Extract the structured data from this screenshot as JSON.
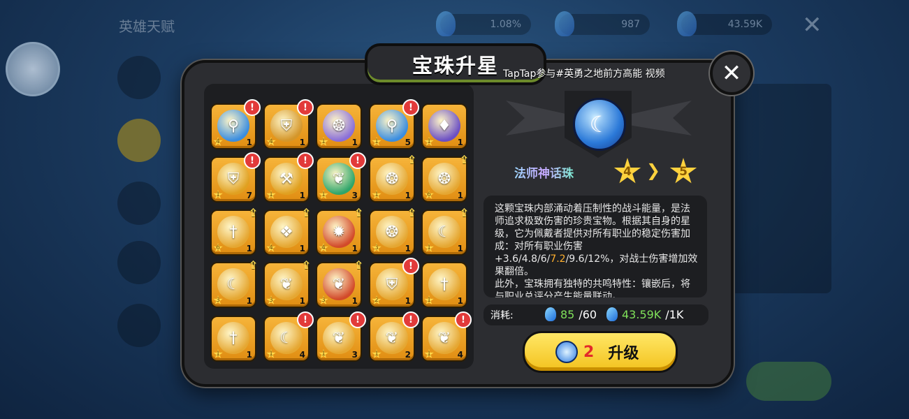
{
  "background": {
    "hud_title": "英雄天赋",
    "resources": [
      "1.08%",
      "987",
      "43.59K"
    ],
    "colors": {
      "bg_dark": "#0f2440",
      "bg_light": "#2d5a86"
    }
  },
  "modal": {
    "title": "宝珠升星",
    "watermark": "TapTap参与#英勇之地前方高能 视频",
    "close_icon": "close-x-icon"
  },
  "orb_grid": {
    "rows": [
      [
        {
          "icon": "staff-icon",
          "glyph": "⚲",
          "color": "#3a8de0",
          "star": "4",
          "count": "1",
          "alert": true
        },
        {
          "icon": "shield-icon",
          "glyph": "⛨",
          "color": "#d4962a",
          "star": "4",
          "count": "1",
          "alert": true
        },
        {
          "icon": "swirl-icon",
          "glyph": "❂",
          "color": "#8a6fd8",
          "star": "1",
          "count": "1",
          "alert": false
        },
        {
          "icon": "staff-icon",
          "glyph": "⚲",
          "color": "#3a8de0",
          "star": "1",
          "count": "5",
          "alert": true
        },
        {
          "icon": "dagger-icon",
          "glyph": "♦",
          "color": "#6b4fc4",
          "star": "1",
          "count": "1",
          "alert": false
        }
      ],
      [
        {
          "icon": "shield-icon",
          "glyph": "⛨",
          "color": "#e0a020",
          "star": "1",
          "count": "7",
          "alert": true
        },
        {
          "icon": "hammer-icon",
          "glyph": "⚒",
          "color": "#e0a020",
          "star": "1",
          "count": "1",
          "alert": true
        },
        {
          "icon": "leaf-icon",
          "glyph": "❦",
          "color": "#2ea56a",
          "star": "1",
          "count": "3",
          "alert": true
        },
        {
          "icon": "swirl-icon",
          "glyph": "❂",
          "color": "#e5a732",
          "star": "1",
          "count": "1",
          "up": true
        },
        {
          "icon": "swirl-icon",
          "glyph": "❂",
          "color": "#e5a732",
          "star": "6",
          "count": "1",
          "up": true
        }
      ],
      [
        {
          "icon": "sword-icon",
          "glyph": "†",
          "color": "#e5a732",
          "star": "6",
          "count": "1",
          "up": true
        },
        {
          "icon": "drop-icon",
          "glyph": "❖",
          "color": "#e5a732",
          "star": "4",
          "count": "1",
          "up": true
        },
        {
          "icon": "flame-icon",
          "glyph": "✹",
          "color": "#d24a2a",
          "star": "4",
          "count": "1",
          "up": true
        },
        {
          "icon": "swirl-icon",
          "glyph": "❂",
          "color": "#e5a732",
          "star": "3",
          "count": "1",
          "up": true
        },
        {
          "icon": "crescent-icon",
          "glyph": "☾",
          "color": "#e5a732",
          "star": "1",
          "count": "1",
          "up": true
        }
      ],
      [
        {
          "icon": "crescent-icon",
          "glyph": "☾",
          "color": "#e5a732",
          "star": "3",
          "count": "1",
          "up": true
        },
        {
          "icon": "butterfly-icon",
          "glyph": "❦",
          "color": "#e5a732",
          "star": "3",
          "count": "1",
          "up": true
        },
        {
          "icon": "butterfly-icon",
          "glyph": "❦",
          "color": "#d24a2a",
          "star": "3",
          "count": "1",
          "up": true
        },
        {
          "icon": "shield-icon",
          "glyph": "⛨",
          "color": "#e5a732",
          "star": "2",
          "count": "1",
          "alert": true
        },
        {
          "icon": "sword-icon",
          "glyph": "†",
          "color": "#e5a732",
          "star": "1",
          "count": "1",
          "alert": false
        }
      ],
      [
        {
          "icon": "sword-icon",
          "glyph": "†",
          "color": "#e5a732",
          "star": "1",
          "count": "1",
          "alert": false
        },
        {
          "icon": "crescent-icon",
          "glyph": "☾",
          "color": "#e5a732",
          "star": "1",
          "count": "4",
          "alert": true
        },
        {
          "icon": "butterfly-icon",
          "glyph": "❦",
          "color": "#e5a732",
          "star": "1",
          "count": "3",
          "alert": true
        },
        {
          "icon": "butterfly-icon",
          "glyph": "❦",
          "color": "#e5a732",
          "star": "1",
          "count": "2",
          "alert": true
        },
        {
          "icon": "butterfly-icon",
          "glyph": "❦",
          "color": "#e5a732",
          "star": "1",
          "count": "4",
          "alert": true
        }
      ]
    ]
  },
  "selected_orb": {
    "icon": "mage-myth-orb-icon",
    "name": "法师神话珠",
    "star_from": "4",
    "star_to": "5",
    "description_parts": [
      "这颗宝珠内部涌动着压制性的战斗能量，是法师追求极致伤害的珍贵宝物。根据其自身的星级，它为佩戴者提供对所有职业的稳定伤害加成：对所有职业伤害+3.6/4.8/6/",
      "7.2",
      "/9.6/12%，对战士伤害增加效果翻倍。",
      "此外，宝珠拥有独特的共鸣特性：镶嵌后，将与职业总评分产生能量联动。"
    ]
  },
  "cost": {
    "label": "消耗:",
    "item1_have": "85",
    "item1_need": "/60",
    "item2_have": "43.59K",
    "item2_need": "/1K"
  },
  "upgrade_button": {
    "count": "2",
    "label": "升级"
  }
}
